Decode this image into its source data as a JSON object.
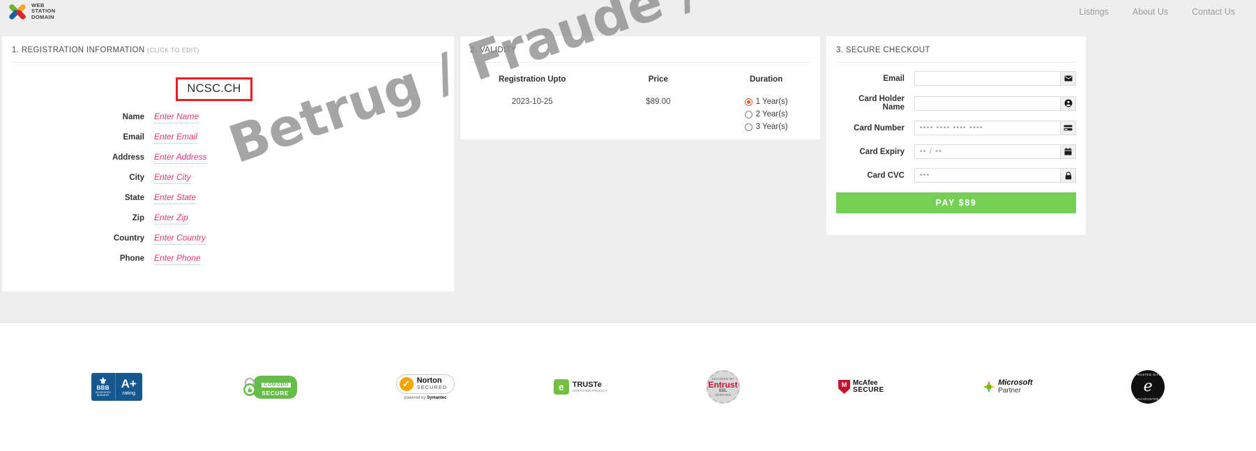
{
  "header": {
    "brand": {
      "line1": "WEB",
      "line2": "STATION",
      "line3": "DOMAIN"
    },
    "nav": [
      {
        "label": "Listings"
      },
      {
        "label": "About Us"
      },
      {
        "label": "Contact Us"
      }
    ]
  },
  "registration": {
    "title": "1. REGISTRATION INFORMATION",
    "title_hint": "(CLICK TO EDIT)",
    "domain": "NCSC.CH",
    "fields": [
      {
        "label": "Name",
        "placeholder": "Enter Name"
      },
      {
        "label": "Email",
        "placeholder": "Enter Email"
      },
      {
        "label": "Address",
        "placeholder": "Enter Address"
      },
      {
        "label": "City",
        "placeholder": "Enter City"
      },
      {
        "label": "State",
        "placeholder": "Enter State"
      },
      {
        "label": "Zip",
        "placeholder": "Enter Zip"
      },
      {
        "label": "Country",
        "placeholder": "Enter Country"
      },
      {
        "label": "Phone",
        "placeholder": "Enter Phone"
      }
    ]
  },
  "validity": {
    "title": "2. VALIDITY",
    "columns": {
      "registration_upto": "Registration Upto",
      "price": "Price",
      "duration": "Duration"
    },
    "registration_upto_value": "2023-10-25",
    "price_value": "$89.00",
    "durations": [
      {
        "label": "1 Year(s)",
        "selected": true
      },
      {
        "label": "2 Year(s)",
        "selected": false
      },
      {
        "label": "3 Year(s)",
        "selected": false
      }
    ]
  },
  "checkout": {
    "title": "3. SECURE CHECKOUT",
    "fields": [
      {
        "label": "Email",
        "value": "",
        "icon": "envelope-icon"
      },
      {
        "label": "Card Holder Name",
        "value": "",
        "icon": "user-icon"
      },
      {
        "label": "Card Number",
        "value": "••••  ••••  ••••  ••••",
        "icon": "credit-card-icon"
      },
      {
        "label": "Card Expiry",
        "value": "•• / ••",
        "icon": "calendar-icon"
      },
      {
        "label": "Card CVC",
        "value": "•••",
        "icon": "lock-icon"
      }
    ],
    "pay_label": "PAY $89",
    "pay_color": "#74cf54"
  },
  "watermark": {
    "text": "Betrug / Fraude / Frode / Fraud",
    "color": "#8c8c8c"
  },
  "footer": {
    "badges": [
      {
        "name": "bbb-accredited-business-badge",
        "torch": "⚜",
        "bbb": "BBB",
        "sub1": "ACCREDITED",
        "sub2": "BUSINESS",
        "grade": "A",
        "plus": "+",
        "rating": "rating"
      },
      {
        "name": "comodo-secure-badge",
        "top": "COMODO",
        "bottom": "SECURE"
      },
      {
        "name": "norton-secured-badge",
        "main": "Norton",
        "sub": "SECURED",
        "powered": "powered by ",
        "powered_brand": "Symantec"
      },
      {
        "name": "truste-certified-privacy-badge",
        "main": "TRUSTe",
        "sub": "CERTIFIED PRIVACY"
      },
      {
        "name": "entrust-ssl-badge",
        "top": "SECURED BY",
        "main": "Entrust",
        "ssl": "SSL",
        "bottom": "VERIFIED"
      },
      {
        "name": "mcafee-secure-badge",
        "line1": "McAfee",
        "line2": "SECURE"
      },
      {
        "name": "microsoft-partner-badge",
        "line1": "Microsoft",
        "line2": "Partner"
      },
      {
        "name": "trusted-site-guarantee-seal",
        "top": "TRUSTED SITE",
        "letter": "e",
        "bottom": "GUARANTEE"
      }
    ]
  }
}
